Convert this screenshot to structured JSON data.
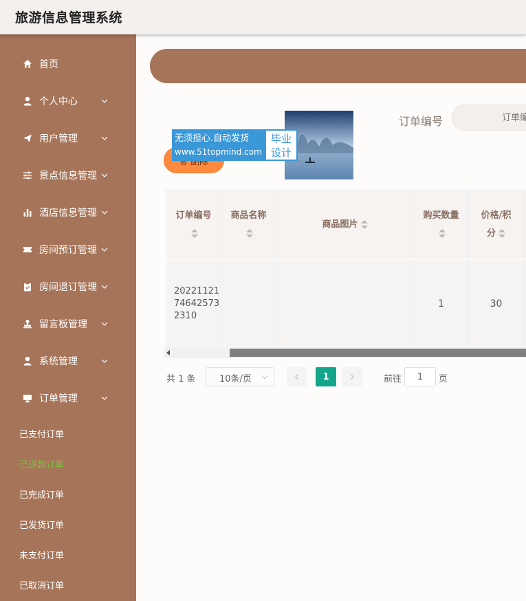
{
  "app": {
    "title": "旅游信息管理系统"
  },
  "sidebar": {
    "items": [
      {
        "label": "首页",
        "icon": "home-icon",
        "arrow": false
      },
      {
        "label": "个人中心",
        "icon": "user-icon",
        "arrow": true
      },
      {
        "label": "用户管理",
        "icon": "send-icon",
        "arrow": true
      },
      {
        "label": "景点信息管理",
        "icon": "sliders-icon",
        "arrow": true
      },
      {
        "label": "酒店信息管理",
        "icon": "bar-chart-icon",
        "arrow": true
      },
      {
        "label": "房间预订管理",
        "icon": "ticket-icon",
        "arrow": true
      },
      {
        "label": "房间退订管理",
        "icon": "clipboard-icon",
        "arrow": true
      },
      {
        "label": "留言板管理",
        "icon": "stamp-icon",
        "arrow": true
      },
      {
        "label": "系统管理",
        "icon": "user-icon",
        "arrow": true
      },
      {
        "label": "订单管理",
        "icon": "monitor-icon",
        "arrow": true
      }
    ],
    "order_sub": [
      "已支付订单",
      "已退款订单",
      "已完成订单",
      "已发货订单",
      "未支付订单",
      "已取消订单"
    ],
    "active_sub": "已退款订单"
  },
  "search": {
    "label": "订单编号",
    "placeholder": "订单编号"
  },
  "toolbar": {
    "delete_label": "删除"
  },
  "table": {
    "columns": [
      "订单编号",
      "商品名称",
      "商品图片",
      "购买数量",
      "价格/积分"
    ],
    "rows": [
      {
        "order_no": "20221121746425732310",
        "name": "",
        "quantity": "1",
        "price": "30"
      }
    ]
  },
  "watermark": {
    "line1": "无须担心.自动发货",
    "line2": "www.51topmind.com",
    "right1": "毕业",
    "right2": "设计"
  },
  "pagination": {
    "total": "共 1 条",
    "page_size": "10条/页",
    "current": "1",
    "goto_prefix": "前往",
    "goto_value": "1",
    "goto_suffix": "页"
  },
  "colors": {
    "sidebar": "#a67458",
    "active_sub": "#7bc13e",
    "delete": "#ff8a3d",
    "page_active": "#13a58b"
  }
}
